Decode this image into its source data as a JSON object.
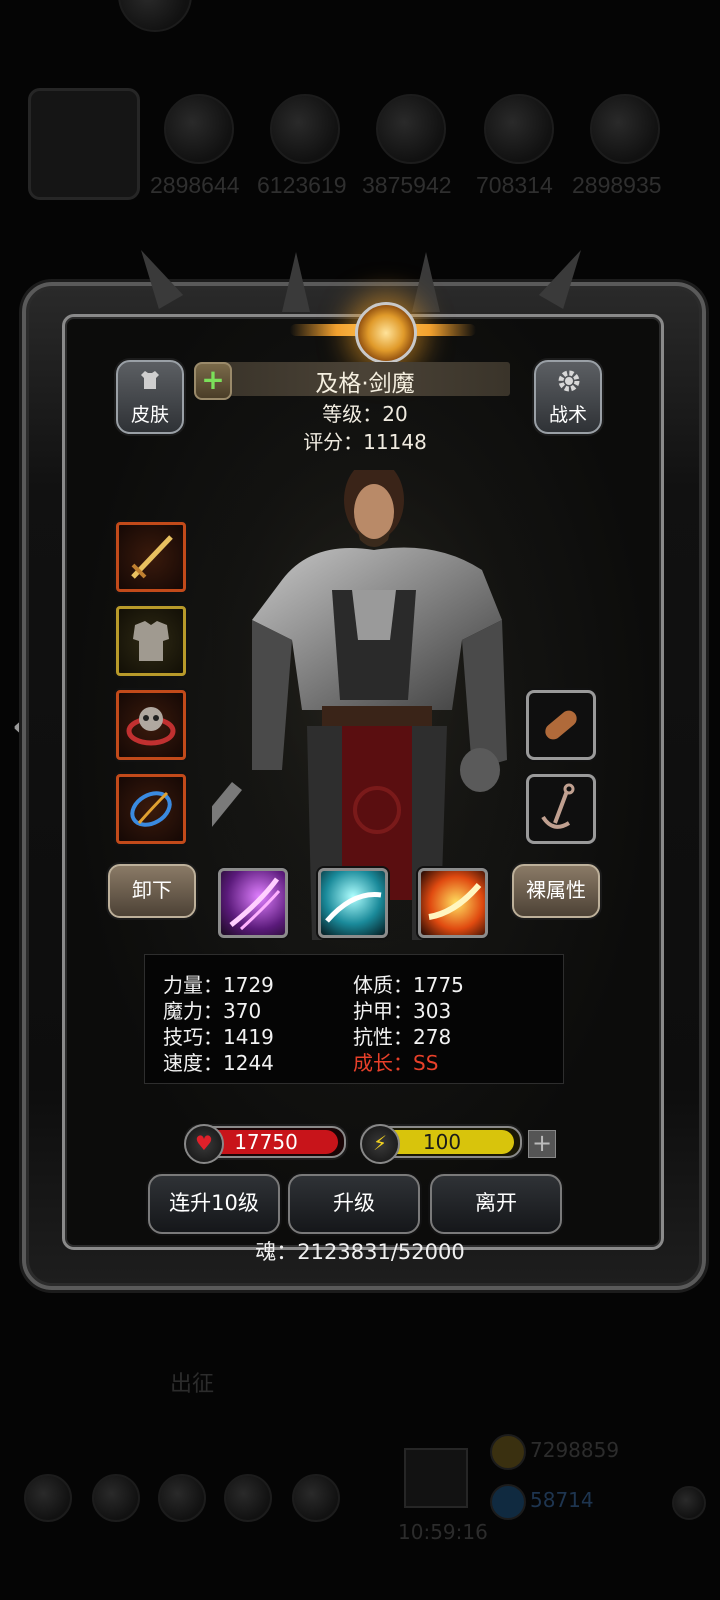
{
  "background": {
    "numbers": [
      "2898644",
      "6123619",
      "3875942",
      "708314",
      "2898935"
    ],
    "expedition_label": "出征",
    "resource_gold": "7298859",
    "resource_gem": "58714",
    "clock": "10:59:16"
  },
  "hero": {
    "name": "及格·剑魔",
    "level": "等级：20",
    "score": "评分：11148",
    "add_icon": "plus-icon"
  },
  "buttons": {
    "skin": "皮肤",
    "tactics": "战术",
    "unequip": "卸下",
    "base_attributes": "裸属性",
    "level_up_10": "连升10级",
    "level_up": "升级",
    "leave": "离开"
  },
  "equipment_slots": [
    {
      "item": "sword-icon",
      "rarity": "red"
    },
    {
      "item": "armor-icon",
      "rarity": "gold"
    },
    {
      "item": "skull-ring-icon",
      "rarity": "red"
    },
    {
      "item": "amulet-icon",
      "rarity": "red"
    },
    {
      "item": "scroll-icon",
      "rarity": "empty"
    },
    {
      "item": "anchor-icon",
      "rarity": "empty"
    }
  ],
  "skills": [
    "purple-slash-skill-icon",
    "cyan-wave-skill-icon",
    "fire-slash-skill-icon"
  ],
  "stats": {
    "strength": "力量：1729",
    "constitution": "体质：1775",
    "magic": "魔力：370",
    "armor": "护甲：303",
    "skill": "技巧：1419",
    "resistance": "抗性：278",
    "speed": "速度：1244",
    "growth": "成长：SS"
  },
  "hp": {
    "value": "17750",
    "fill_fraction": 1.0,
    "color": "#c8141a"
  },
  "energy": {
    "value": "100",
    "fill_fraction": 1.0,
    "color": "#d8c40c"
  },
  "soul": "魂：2123831/52000",
  "colors": {
    "growth_text": "#e8402a",
    "emblem_glow": "#f0a030"
  }
}
